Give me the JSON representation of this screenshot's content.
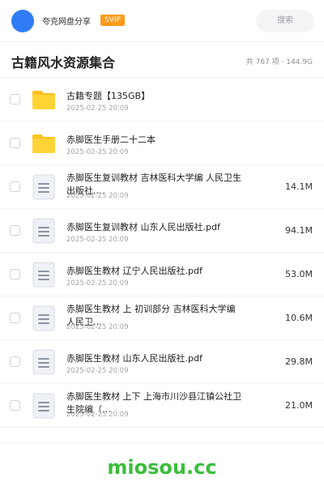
{
  "header": {
    "owner": "夸克网盘分享",
    "badge": "SVIP",
    "search_label": "搜索",
    "accent": "#2f7cf6"
  },
  "title_row": {
    "title": "古籍风水资源集合",
    "stats": "共 767 项 · 144.9G"
  },
  "items": [
    {
      "icon": "folder-icon",
      "name": "古籍专题【135GB】",
      "date": "2025-02-25 20:09",
      "size": ""
    },
    {
      "icon": "folder-icon",
      "name": "赤脚医生手册二十二本",
      "date": "2025-02-25 20:09",
      "size": ""
    },
    {
      "icon": "document-icon",
      "name": "赤脚医生复训教材 吉林医科大学编 人民卫生出版社.…",
      "date": "2025-02-25 20:09",
      "size": "14.1M"
    },
    {
      "icon": "document-icon",
      "name": "赤脚医生复训教材 山东人民出版社.pdf",
      "date": "2025-02-25 20:09",
      "size": "94.1M"
    },
    {
      "icon": "document-icon",
      "name": "赤脚医生教材 辽宁人民出版社.pdf",
      "date": "2025-02-25 20:09",
      "size": "53.0M"
    },
    {
      "icon": "document-icon",
      "name": "赤脚医生教材 上 初训部分 吉林医科大学编 人民卫…",
      "date": "2025-02-25 20:09",
      "size": "10.6M"
    },
    {
      "icon": "document-icon",
      "name": "赤脚医生教材 山东人民出版社.pdf",
      "date": "2025-02-25 20:09",
      "size": "29.8M"
    },
    {
      "icon": "document-icon",
      "name": "赤脚医生教材 上下 上海市川沙县江镇公社卫生院编（…",
      "date": "2025-02-25 20:09",
      "size": "21.0M"
    }
  ],
  "watermark": "miosou.cc"
}
